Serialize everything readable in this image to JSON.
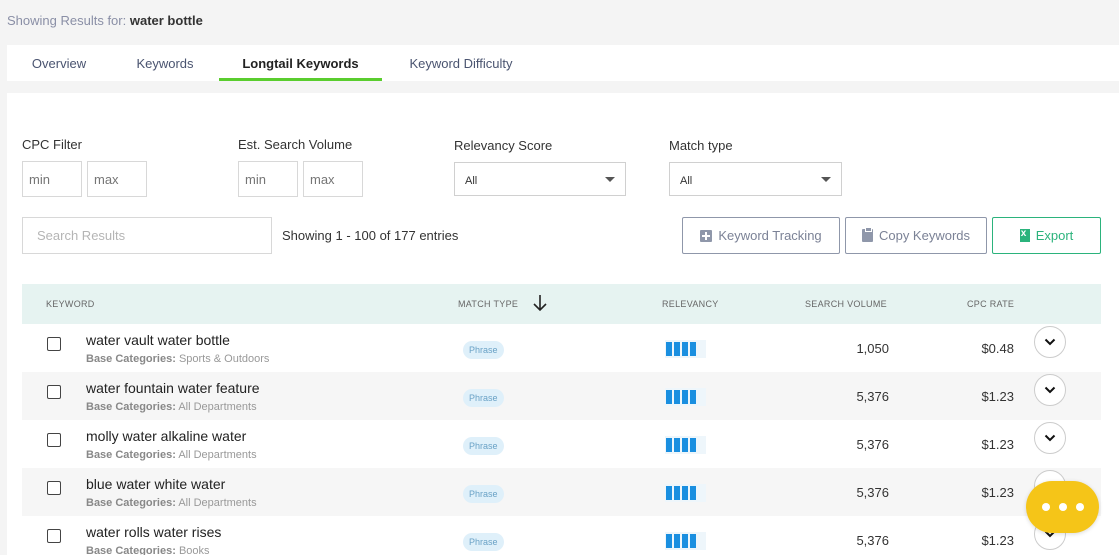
{
  "header": {
    "prefix": "Showing Results for:",
    "query": "water bottle"
  },
  "tabs": [
    {
      "label": "Overview"
    },
    {
      "label": "Keywords"
    },
    {
      "label": "Longtail Keywords"
    },
    {
      "label": "Keyword Difficulty"
    }
  ],
  "filters": {
    "cpc": {
      "label": "CPC Filter",
      "min_placeholder": "min",
      "max_placeholder": "max"
    },
    "volume": {
      "label": "Est. Search Volume",
      "min_placeholder": "min",
      "max_placeholder": "max"
    },
    "relevancy": {
      "label": "Relevancy Score",
      "value": "All"
    },
    "match": {
      "label": "Match type",
      "value": "All"
    }
  },
  "search": {
    "placeholder": "Search Results"
  },
  "showing": "Showing 1 - 100 of 177 entries",
  "buttons": {
    "tracking": "Keyword Tracking",
    "copy": "Copy Keywords",
    "export": "Export"
  },
  "columns": {
    "keyword": "KEYWORD",
    "match": "MATCH TYPE",
    "relevancy": "RELEVANCY",
    "volume": "SEARCH VOLUME",
    "cpc": "CPC RATE"
  },
  "category_prefix": "Base Categories:",
  "rows": [
    {
      "keyword": "water vault water bottle",
      "category": "Sports & Outdoors",
      "match": "Phrase",
      "relevancy_bars": 4,
      "volume": "1,050",
      "cpc": "$0.48"
    },
    {
      "keyword": "water fountain water feature",
      "category": "All Departments",
      "match": "Phrase",
      "relevancy_bars": 4,
      "volume": "5,376",
      "cpc": "$1.23"
    },
    {
      "keyword": "molly water alkaline water",
      "category": "All Departments",
      "match": "Phrase",
      "relevancy_bars": 4,
      "volume": "5,376",
      "cpc": "$1.23"
    },
    {
      "keyword": "blue water white water",
      "category": "All Departments",
      "match": "Phrase",
      "relevancy_bars": 4,
      "volume": "5,376",
      "cpc": "$1.23"
    },
    {
      "keyword": "water rolls water rises",
      "category": "Books",
      "match": "Phrase",
      "relevancy_bars": 4,
      "volume": "5,376",
      "cpc": "$1.23"
    }
  ],
  "colors": {
    "accent_tab": "#5acd2e",
    "relevancy_bar": "#1a8fe0",
    "export": "#2bb37c",
    "chat": "#f5c518"
  },
  "icons": {
    "sort": "arrow-down-icon",
    "expand": "chevron-down-icon",
    "chat": "chat-dots-icon"
  }
}
